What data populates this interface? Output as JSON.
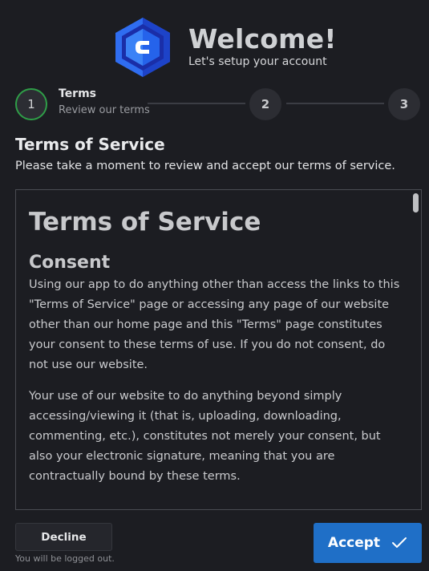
{
  "header": {
    "title": "Welcome!",
    "subtitle": "Let's setup your account",
    "logo_icon": "hexagon-c-logo-icon"
  },
  "stepper": {
    "steps": [
      {
        "number": "1",
        "title": "Terms",
        "description": "Review our terms",
        "state": "active"
      },
      {
        "number": "2",
        "state": "upcoming"
      },
      {
        "number": "3",
        "state": "upcoming"
      }
    ]
  },
  "section": {
    "title": "Terms of Service",
    "description": "Please take a moment to review and accept our terms of service."
  },
  "terms": {
    "heading": "Terms of Service",
    "subheading": "Consent",
    "paragraphs": [
      "Using our app to do anything other than access the links to this \"Terms of Service\" page or accessing any page of our website other than our home page and this \"Terms\" page constitutes your consent to these terms of use. If you do not consent, do not use our website.",
      "Your use of our website to do anything beyond simply accessing/viewing it (that is, uploading, downloading, commenting, etc.), constitutes not merely your consent, but also your electronic signature, meaning that you are contractually bound by these terms."
    ]
  },
  "footer": {
    "decline_label": "Decline",
    "decline_note": "You will be logged out.",
    "accept_label": "Accept",
    "accept_icon": "check-icon"
  },
  "colors": {
    "background": "#1c1d22",
    "accent": "#1f6fc7",
    "active_step": "#2f9e48",
    "logo_primary": "#2563eb",
    "logo_dark": "#1e3a8a"
  }
}
